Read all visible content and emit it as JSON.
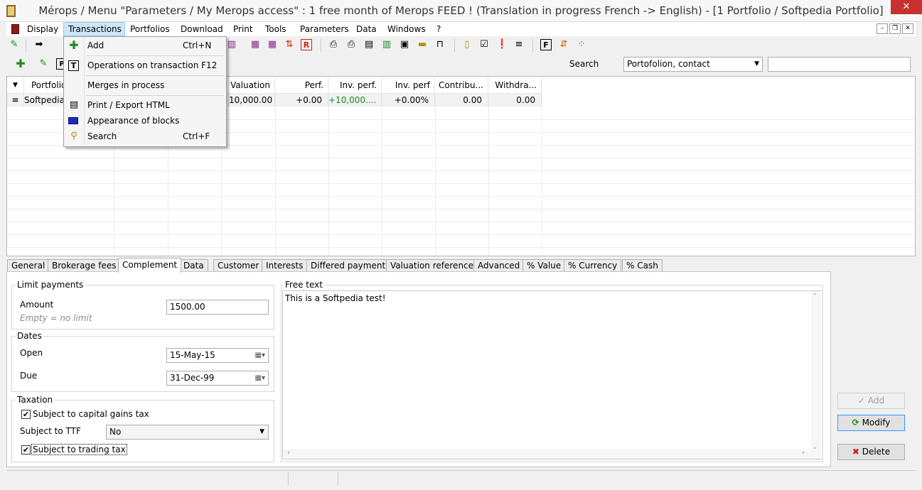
{
  "window": {
    "title": "Mérops / Menu \"Parameters / My Merops access\" : 1 free month of Merops FEED ! (Translation in progress French -> English) - [1 Portfolio / Softpedia Portfolio]",
    "close_glyph": "✕"
  },
  "menu": {
    "items": [
      "Display",
      "Transactions",
      "Portfolios",
      "Download",
      "Print",
      "Tools",
      "Parameters",
      "Data",
      "Windows",
      "?"
    ],
    "active": "Transactions"
  },
  "mdi": {
    "minimize": "–",
    "restore": "❐",
    "close": "✕"
  },
  "transactions_menu": [
    {
      "label": "Add",
      "shortcut": "Ctrl+N",
      "icon": "plus-icon"
    },
    {
      "label": "Operations on transaction F12",
      "shortcut": "",
      "icon": "transaction-t-icon"
    },
    {
      "label": "Merges in process",
      "shortcut": "",
      "icon": ""
    },
    {
      "label": "Print / Export HTML",
      "shortcut": "",
      "icon": "print-export-icon"
    },
    {
      "label": "Appearance of blocks",
      "shortcut": "",
      "icon": "blocks-icon"
    },
    {
      "label": "Search",
      "shortcut": "Ctrl+F",
      "icon": "binoculars-icon"
    }
  ],
  "search": {
    "label": "Search",
    "scope": "Portofolion, contact",
    "value": ""
  },
  "grid": {
    "columns": [
      "Portfolio",
      "Valuation",
      "Perf.",
      "Inv. perf.",
      "Inv. perf",
      "Contribu...",
      "Withdra..."
    ],
    "rows": [
      {
        "portfolio": "Softpedia",
        "valuation": "10,000.00",
        "perf": "+0.00",
        "inv_perf": "+10,000....",
        "inv_perf_pct": "+0.00%",
        "contrib": "0.00",
        "withdraw": "0.00"
      }
    ]
  },
  "tabs": [
    "General",
    "Brokerage fees",
    "Complement",
    "Data",
    "Customer",
    "Interests",
    "Differed payment",
    "Valuation reference",
    "Advanced",
    "% Value",
    "% Currency",
    "% Cash"
  ],
  "active_tab": "Complement",
  "limit_payments": {
    "title": "Limit payments",
    "amount_label": "Amount",
    "amount_value": "1500.00",
    "hint": "Empty = no limit"
  },
  "dates": {
    "title": "Dates",
    "open_label": "Open",
    "open_value": "15-May-15",
    "due_label": "Due",
    "due_value": "31-Dec-99"
  },
  "taxation": {
    "title": "Taxation",
    "capital_gains_label": "Subject to capital gains tax",
    "capital_gains_checked": true,
    "ttf_label": "Subject to TTF",
    "ttf_value": "No",
    "trading_tax_label": "Subject to trading tax",
    "trading_tax_checked": true
  },
  "free_text": {
    "title": "Free text",
    "value": "This is a Softpedia test!"
  },
  "buttons": {
    "add": "Add",
    "modify": "Modify",
    "delete": "Delete"
  },
  "colors": {
    "accent_green": "#1a8a1a",
    "menu_highlight": "#cde6f7",
    "close_red": "#c7312f"
  }
}
